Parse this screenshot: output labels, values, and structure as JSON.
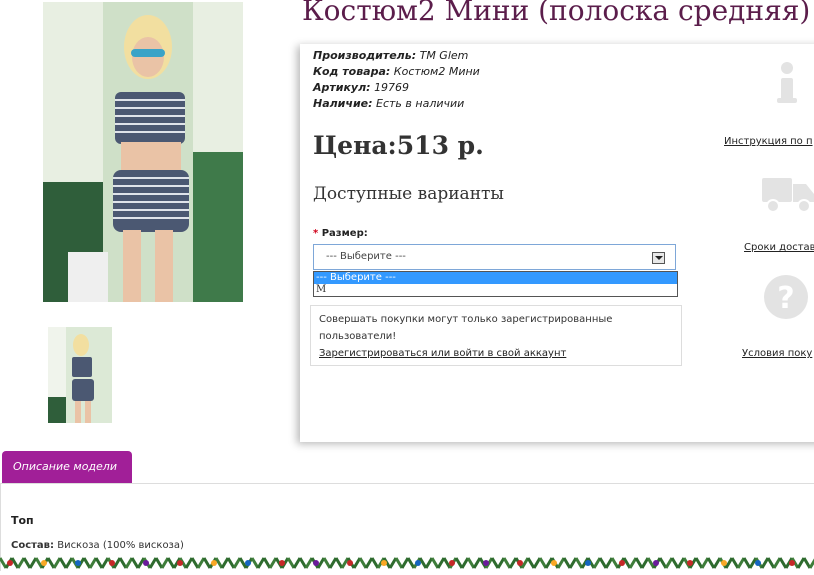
{
  "product": {
    "title": "Костюм2 Мини (полоска средняя)",
    "manufacturer_label": "Производитель:",
    "manufacturer": "TM Glem",
    "code_label": "Код товара:",
    "code": "Костюм2 Мини",
    "article_label": "Артикул:",
    "article": "19769",
    "availability_label": "Наличие:",
    "availability": "Есть в наличии",
    "price": "Цена:513 р."
  },
  "options": {
    "heading": "Доступные варианты",
    "required_mark": "*",
    "size_label": "Размер:",
    "selected": "--- Выберите ---",
    "list": [
      "--- Выберите ---",
      "M"
    ]
  },
  "notice": {
    "text": "Совершать покупки могут только зарегистрированные пользователи!",
    "link": "Зарегистрироваться или войти в свой аккаунт"
  },
  "side": {
    "instructions": "Инструкция по п",
    "delivery": "Сроки достав",
    "terms": "Условия поку"
  },
  "tabs": {
    "description": "Описание модели"
  },
  "description": {
    "top_label": "Топ",
    "composition_label": "Состав:",
    "composition": "Вискоза (100% вискоза)"
  },
  "colors": {
    "title": "#5b1d4b",
    "tab": "#a11f98",
    "select_highlight": "#3399ff"
  }
}
